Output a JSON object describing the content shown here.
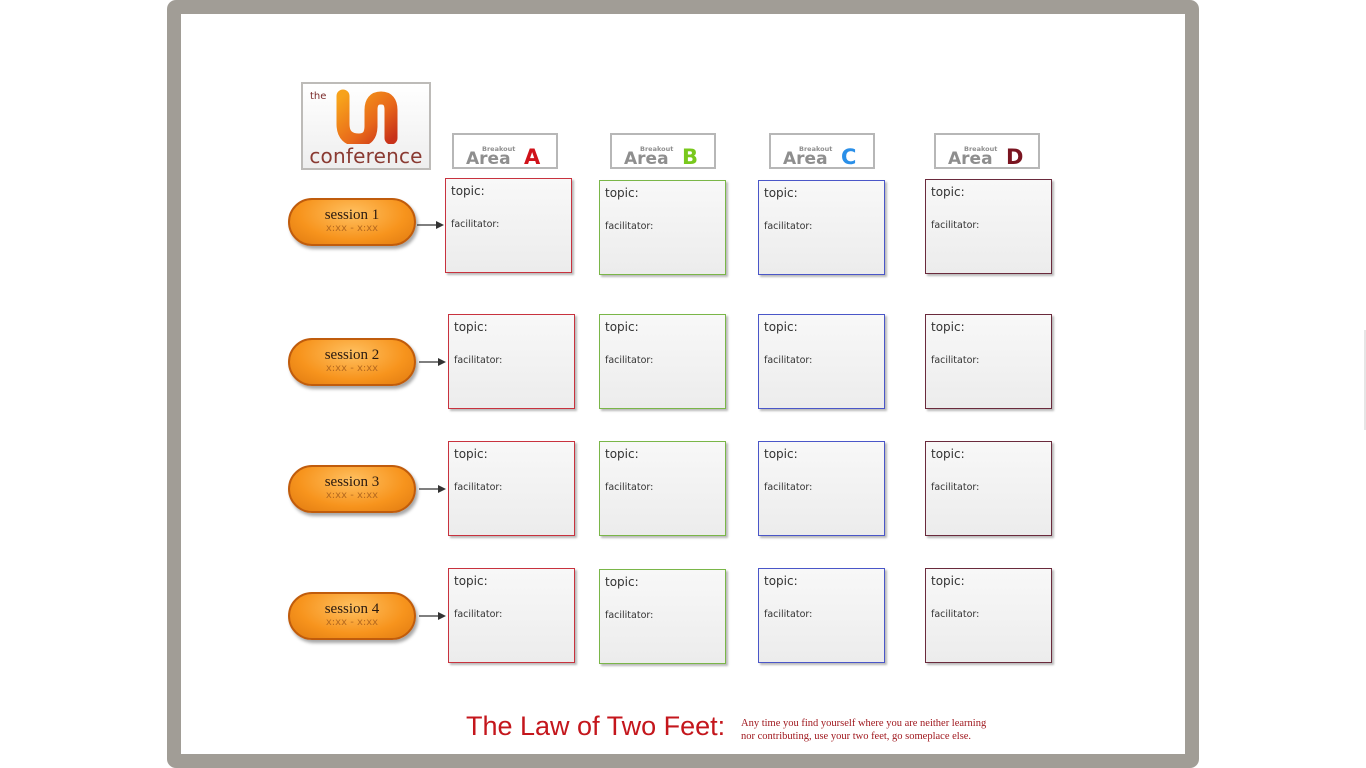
{
  "logo": {
    "prefix": "the",
    "name": "conference"
  },
  "areas": [
    {
      "small": "Breakout",
      "word": "Area",
      "letter": "A",
      "color": "#d0121a"
    },
    {
      "small": "Breakout",
      "word": "Area",
      "letter": "B",
      "color": "#78c81c"
    },
    {
      "small": "Breakout",
      "word": "Area",
      "letter": "C",
      "color": "#2a8fe8"
    },
    {
      "small": "Breakout",
      "word": "Area",
      "letter": "D",
      "color": "#7a1420"
    }
  ],
  "sessions": [
    {
      "label": "session 1",
      "time": "x:xx - x:xx"
    },
    {
      "label": "session 2",
      "time": "x:xx - x:xx"
    },
    {
      "label": "session 3",
      "time": "x:xx - x:xx"
    },
    {
      "label": "session 4",
      "time": "x:xx - x:xx"
    }
  ],
  "card": {
    "topic": "topic:",
    "facilitator": "facilitator:"
  },
  "footer": {
    "title": "The Law of Two Feet:",
    "text_line1": "Any time you find yourself where you are neither learning",
    "text_line2": "nor contributing, use your two feet, go someplace else."
  },
  "colors": {
    "frame": "#a19d96",
    "session_orange": "#f7941d",
    "card_border_a": "#c8323e",
    "card_border_b": "#7ab648",
    "card_border_c": "#4a56c8",
    "card_border_d": "#6a2a3c"
  }
}
